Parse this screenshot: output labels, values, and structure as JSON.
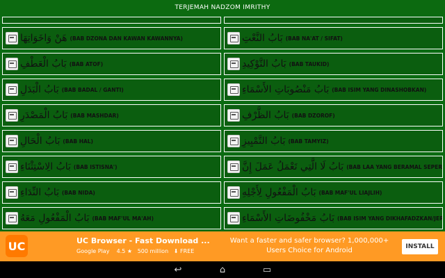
{
  "app": {
    "title": "TERJEMAH NADZOM IMRITHY"
  },
  "rows": [
    {
      "left": {
        "arabic": "هَنْ وَاخَوَاتِهَا",
        "label": "(BAB DZONA DAN KAWAN KAWANNYA)"
      },
      "right": {
        "arabic": "بَابُ النَّعْتِ",
        "label": "(BAB NA'AT / SIFAT)"
      }
    },
    {
      "left": {
        "arabic": "بَابُ الْعَطْفِ",
        "label": "(BAB ATOF)"
      },
      "right": {
        "arabic": "بَابُ التَّوْكِيدِ",
        "label": "(BAB TAUKID)"
      }
    },
    {
      "left": {
        "arabic": "بَابُ الْبَدَلِ",
        "label": "(BAB BADAL / GANTI)"
      },
      "right": {
        "arabic": "بَابُ مَنْصُوبَاتِ الأَسْمَاءِ",
        "label": "(BAB ISIM YANG DINASHOBKAN)"
      }
    },
    {
      "left": {
        "arabic": "بَابُ الْمَصْدَرِ",
        "label": "(BAB MASHDAR)"
      },
      "right": {
        "arabic": "بَابُ الظَّرْفِ",
        "label": "(BAB DZOROF)"
      }
    },
    {
      "left": {
        "arabic": "بَابُ الْحَالِ",
        "label": "(BAB HAL)"
      },
      "right": {
        "arabic": "بَابُ التَّمْيِيزِ",
        "label": "(BAB TAMYIZ)"
      }
    },
    {
      "left": {
        "arabic": "بَابُ الِاسْتِثْنَاءِ",
        "label": "(BAB ISTISNA')"
      },
      "right": {
        "arabic": "بَابُ لَا الَّتِي تَعْمَلُ عَمَلَ إِنَّ",
        "label": "(BAB LAA YANG BERAMAL SEPERTI INNA)"
      }
    },
    {
      "left": {
        "arabic": "بَابُ النِّدَاءِ",
        "label": "(BAB NIDA)"
      },
      "right": {
        "arabic": "بَابُ الْمَفْعُولِ لِأَجْلِهِ",
        "label": "(BAB MAF'UL LIAJLIH)"
      }
    },
    {
      "left": {
        "arabic": "بَابُ الْمَفْعُولِ مَعَهُ",
        "label": "(BAB MAF'UL MA'AH)"
      },
      "right": {
        "arabic": "بَابُ مَخْفُوضَاتِ الأَسْمَاءِ",
        "label": "(BAB ISIM YANG DIKHAFADZKAN/JERKAN)"
      }
    }
  ],
  "ad": {
    "app_name": "UC Browser - Fast Download ...",
    "store": "Google Play",
    "rating": "4.5 ★",
    "downloads": "500 million",
    "price": "FREE",
    "tagline": "Want a faster and safer browser? 1,000,000+ Users Choice for Android",
    "install_label": "INSTALL",
    "accent_color": "#ff9a24"
  },
  "navbar": {
    "back_icon": "back-icon",
    "home_icon": "home-icon",
    "recents_icon": "recents-icon"
  }
}
